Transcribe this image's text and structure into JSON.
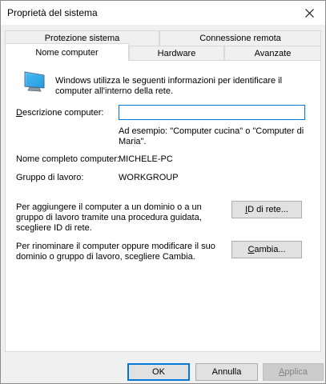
{
  "window": {
    "title": "Proprietà del sistema"
  },
  "tabs": {
    "row1": [
      {
        "label": "Protezione sistema"
      },
      {
        "label": "Connessione remota"
      }
    ],
    "row2": [
      {
        "label": "Nome computer"
      },
      {
        "label": "Hardware"
      },
      {
        "label": "Avanzate"
      }
    ],
    "active": "Nome computer"
  },
  "panel": {
    "intro_line1": "Windows utilizza le seguenti informazioni per identificare il",
    "intro_line2": "computer all'interno della rete.",
    "description_label": "Descrizione computer:",
    "description_value": "",
    "example_line1": "Ad esempio: \"Computer cucina\" o \"Computer di",
    "example_line2": "Maria\".",
    "full_name_label": "Nome completo computer:",
    "full_name_value": "MICHELE-PC",
    "workgroup_label": "Gruppo di lavoro:",
    "workgroup_value": "WORKGROUP",
    "network_text_line1": "Per aggiungere il computer a un dominio o a un",
    "network_text_line2": "gruppo di lavoro tramite una procedura guidata,",
    "network_text_line3": "scegliere ID di rete.",
    "network_id_button": "ID di rete...",
    "rename_text_line1": "Per rinominare il computer oppure modificare il suo",
    "rename_text_line2": "dominio o gruppo di lavoro, scegliere Cambia.",
    "change_button": "Cambia..."
  },
  "footer": {
    "ok": "OK",
    "cancel": "Annulla",
    "apply": "Applica"
  },
  "colors": {
    "accent": "#0078d7",
    "dialog_bg": "#f0f0f0",
    "panel_bg": "#ffffff"
  },
  "icons": {
    "close": "close-icon",
    "computer": "computer-monitor-icon"
  }
}
